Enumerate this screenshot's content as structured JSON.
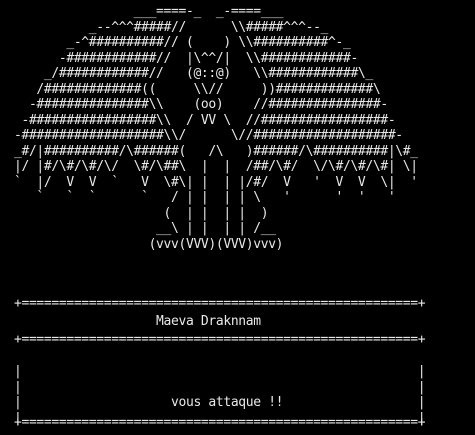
{
  "art": {
    "lines": [
      "                ___====-_  _-====___",
      "          _--^^^#####//      \\\\#####^^^--_",
      "       _-^##########// (    ) \\\\##########^-_",
      "      -############//  |\\^^/|  \\\\############-",
      "    _/############//   (@::@)   \\\\############\\_",
      "   /#############((     \\\\//     ))#############\\",
      "  -###############\\\\    (oo)    //###############-",
      " -#################\\\\  / VV \\  //#################-",
      "-###################\\\\/      \\//###################-",
      "_#/|##########/\\######(   /\\   )######/\\##########|\\#_",
      "|/ |#/\\#/\\#/\\/  \\#/\\##\\  |  |  /##/\\#/  \\/\\#/\\#/\\#| \\|",
      "`  |/  V  V  `   V  \\#\\| |  | |/#/  V   '  V  V  \\|  '",
      "   `   `  `      `   / | |  | | \\   '      '  '   '",
      "                    (  | |  | |  )",
      "                   __\\ | |  | | /__",
      "                  (vvv(VVV)(VVV)vvv)"
    ]
  },
  "banner": {
    "border": "+=====================================================+",
    "name": "                   Maeva Draknnam"
  },
  "message": {
    "lines": [
      "|                                                     |",
      "|                                                     |",
      "|                    vous attaque !!                  |",
      "|                                                     |"
    ],
    "border": "+=====================================================+"
  }
}
